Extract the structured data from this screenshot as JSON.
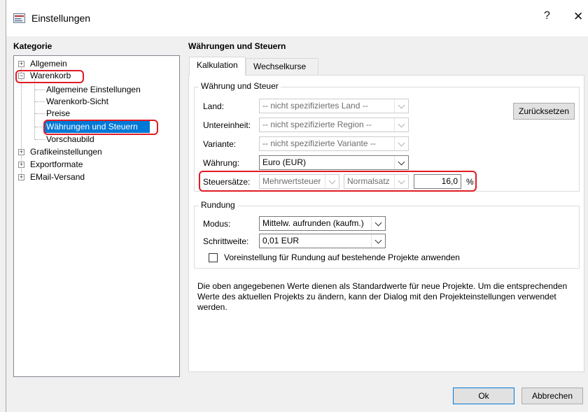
{
  "window": {
    "title": "Einstellungen",
    "help_label": "?",
    "close_label": "✕"
  },
  "sidebar": {
    "heading": "Kategorie",
    "items": [
      {
        "label": "Allgemein"
      },
      {
        "label": "Warenkorb"
      },
      {
        "label": "Allgemeine Einstellungen"
      },
      {
        "label": "Warenkorb-Sicht"
      },
      {
        "label": "Preise"
      },
      {
        "label": "Währungen und Steuern"
      },
      {
        "label": "Vorschaubild"
      },
      {
        "label": "Grafikeinstellungen"
      },
      {
        "label": "Exportformate"
      },
      {
        "label": "EMail-Versand"
      }
    ],
    "selected": "Währungen und Steuern"
  },
  "main": {
    "title": "Währungen und Steuern",
    "tabs": [
      {
        "label": "Kalkulation"
      },
      {
        "label": "Wechselkurse"
      }
    ],
    "currency_group": {
      "title": "Währung und Steuer",
      "land_label": "Land:",
      "land_value": "-- nicht spezifiziertes Land --",
      "region_label": "Untereinheit:",
      "region_value": "-- nicht spezifizierte Region --",
      "variant_label": "Variante:",
      "variant_value": "-- nicht spezifizierte Variante --",
      "currency_label": "Währung:",
      "currency_value": "Euro (EUR)",
      "tax_label": "Steuersätze:",
      "tax_type_value": "Mehrwertsteuer",
      "tax_rate_type_value": "Normalsatz",
      "tax_rate_value": "16,0",
      "tax_unit": "%",
      "reset_label": "Zurücksetzen"
    },
    "rounding_group": {
      "title": "Rundung",
      "mode_label": "Modus:",
      "mode_value": "Mittelw. aufrunden (kaufm.)",
      "step_label": "Schrittweite:",
      "step_value": "0,01 EUR",
      "apply_existing_label": "Voreinstellung für Rundung auf bestehende Projekte anwenden",
      "apply_existing_checked": false
    },
    "info_text": "Die oben angegebenen Werte dienen als Standardwerte für neue Projekte. Um die entsprechenden Werte des aktuellen Projekts zu ändern, kann der Dialog mit den Projekteinstellungen verwendet werden."
  },
  "footer": {
    "ok_label": "Ok",
    "cancel_label": "Abbrechen"
  },
  "colors": {
    "selection": "#0078d7",
    "highlight_outline": "#e01b24"
  }
}
